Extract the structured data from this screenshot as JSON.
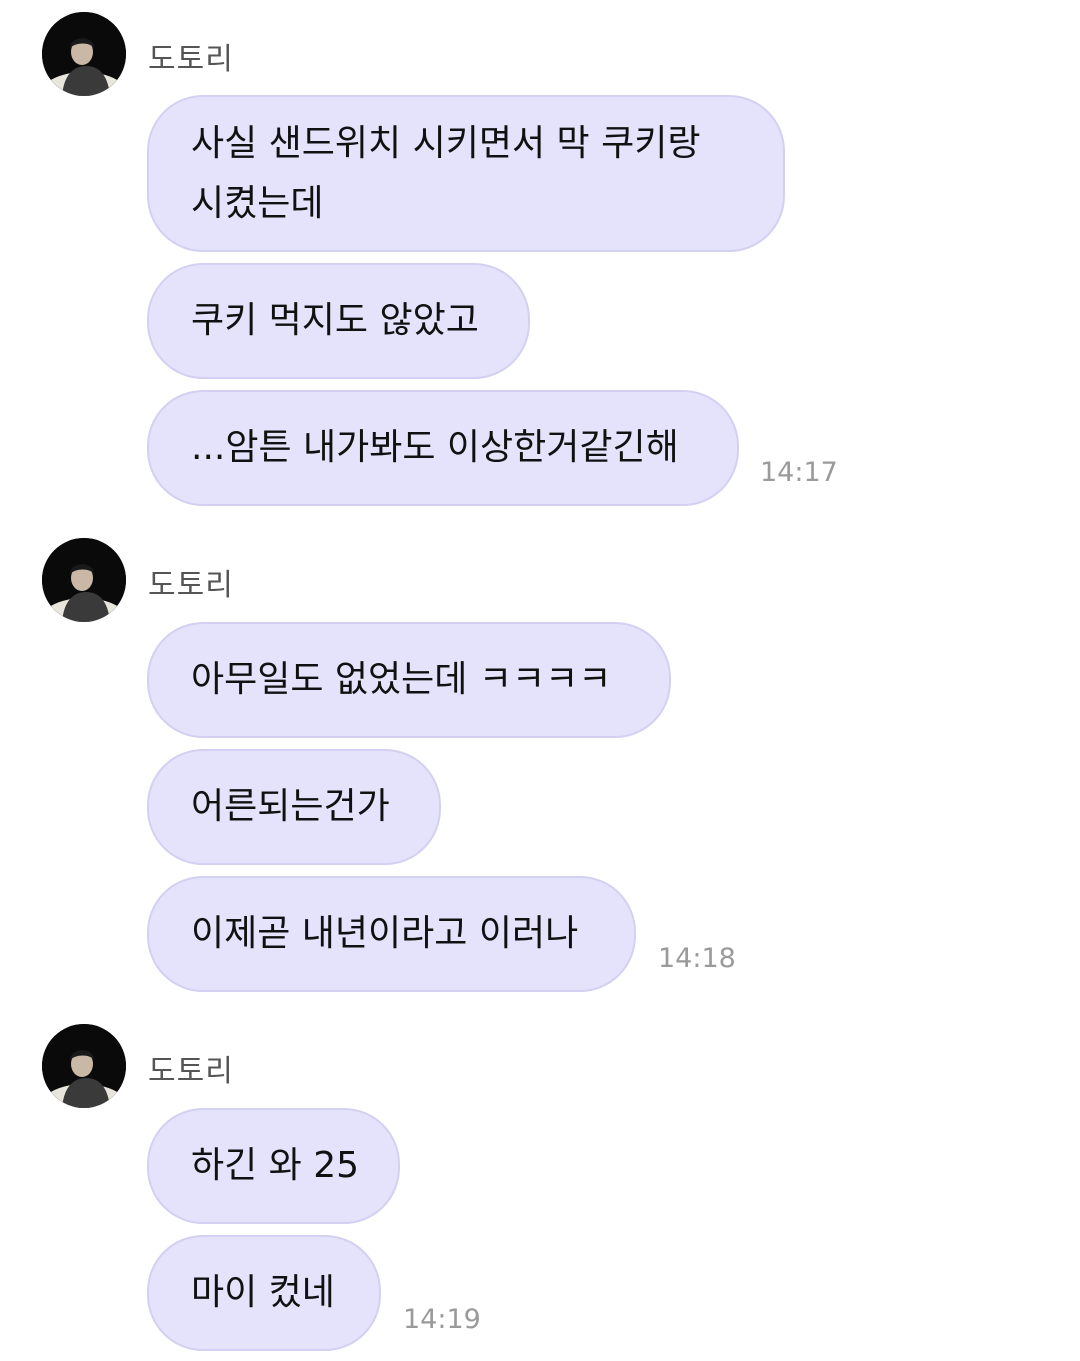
{
  "groups": [
    {
      "sender": "도토리",
      "messages": [
        {
          "text": "사실 샌드위치 시키면서 막 쿠키랑\n시켰는데"
        },
        {
          "text": "쿠키 먹지도 않았고"
        },
        {
          "text": "...암튼 내가봐도 이상한거같긴해"
        }
      ],
      "time": "14:17"
    },
    {
      "sender": "도토리",
      "messages": [
        {
          "text": "아무일도 없었는데 ㅋㅋㅋㅋ"
        },
        {
          "text": "어른되는건가"
        },
        {
          "text": "이제곧 내년이라고 이러나"
        }
      ],
      "time": "14:18"
    },
    {
      "sender": "도토리",
      "messages": [
        {
          "text": "하긴 와 25"
        },
        {
          "text": "마이 컸네"
        }
      ],
      "time": "14:19"
    }
  ],
  "colors": {
    "bubble": "#e5e3fb",
    "bubble_border": "#d3d0f2",
    "sender": "#555555",
    "time": "#9a9a9a"
  },
  "icons": {
    "avatar": "profile-photo-icon"
  }
}
